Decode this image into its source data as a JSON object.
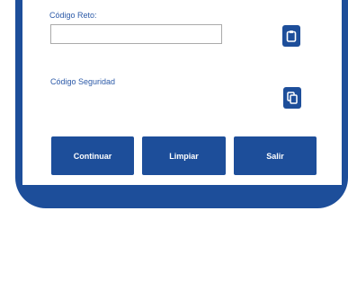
{
  "form": {
    "codigo_reto_label": "Código Reto:",
    "codigo_reto_value": "",
    "codigo_seguridad_label": "Código Seguridad"
  },
  "actions": {
    "continuar_label": "Continuar",
    "limpiar_label": "Limpiar",
    "salir_label": "Salir"
  },
  "icons": {
    "paste": "clipboard-icon",
    "copy": "copy-icon"
  },
  "colors": {
    "brand": "#1d4e9a",
    "label": "#2c5aa8"
  }
}
